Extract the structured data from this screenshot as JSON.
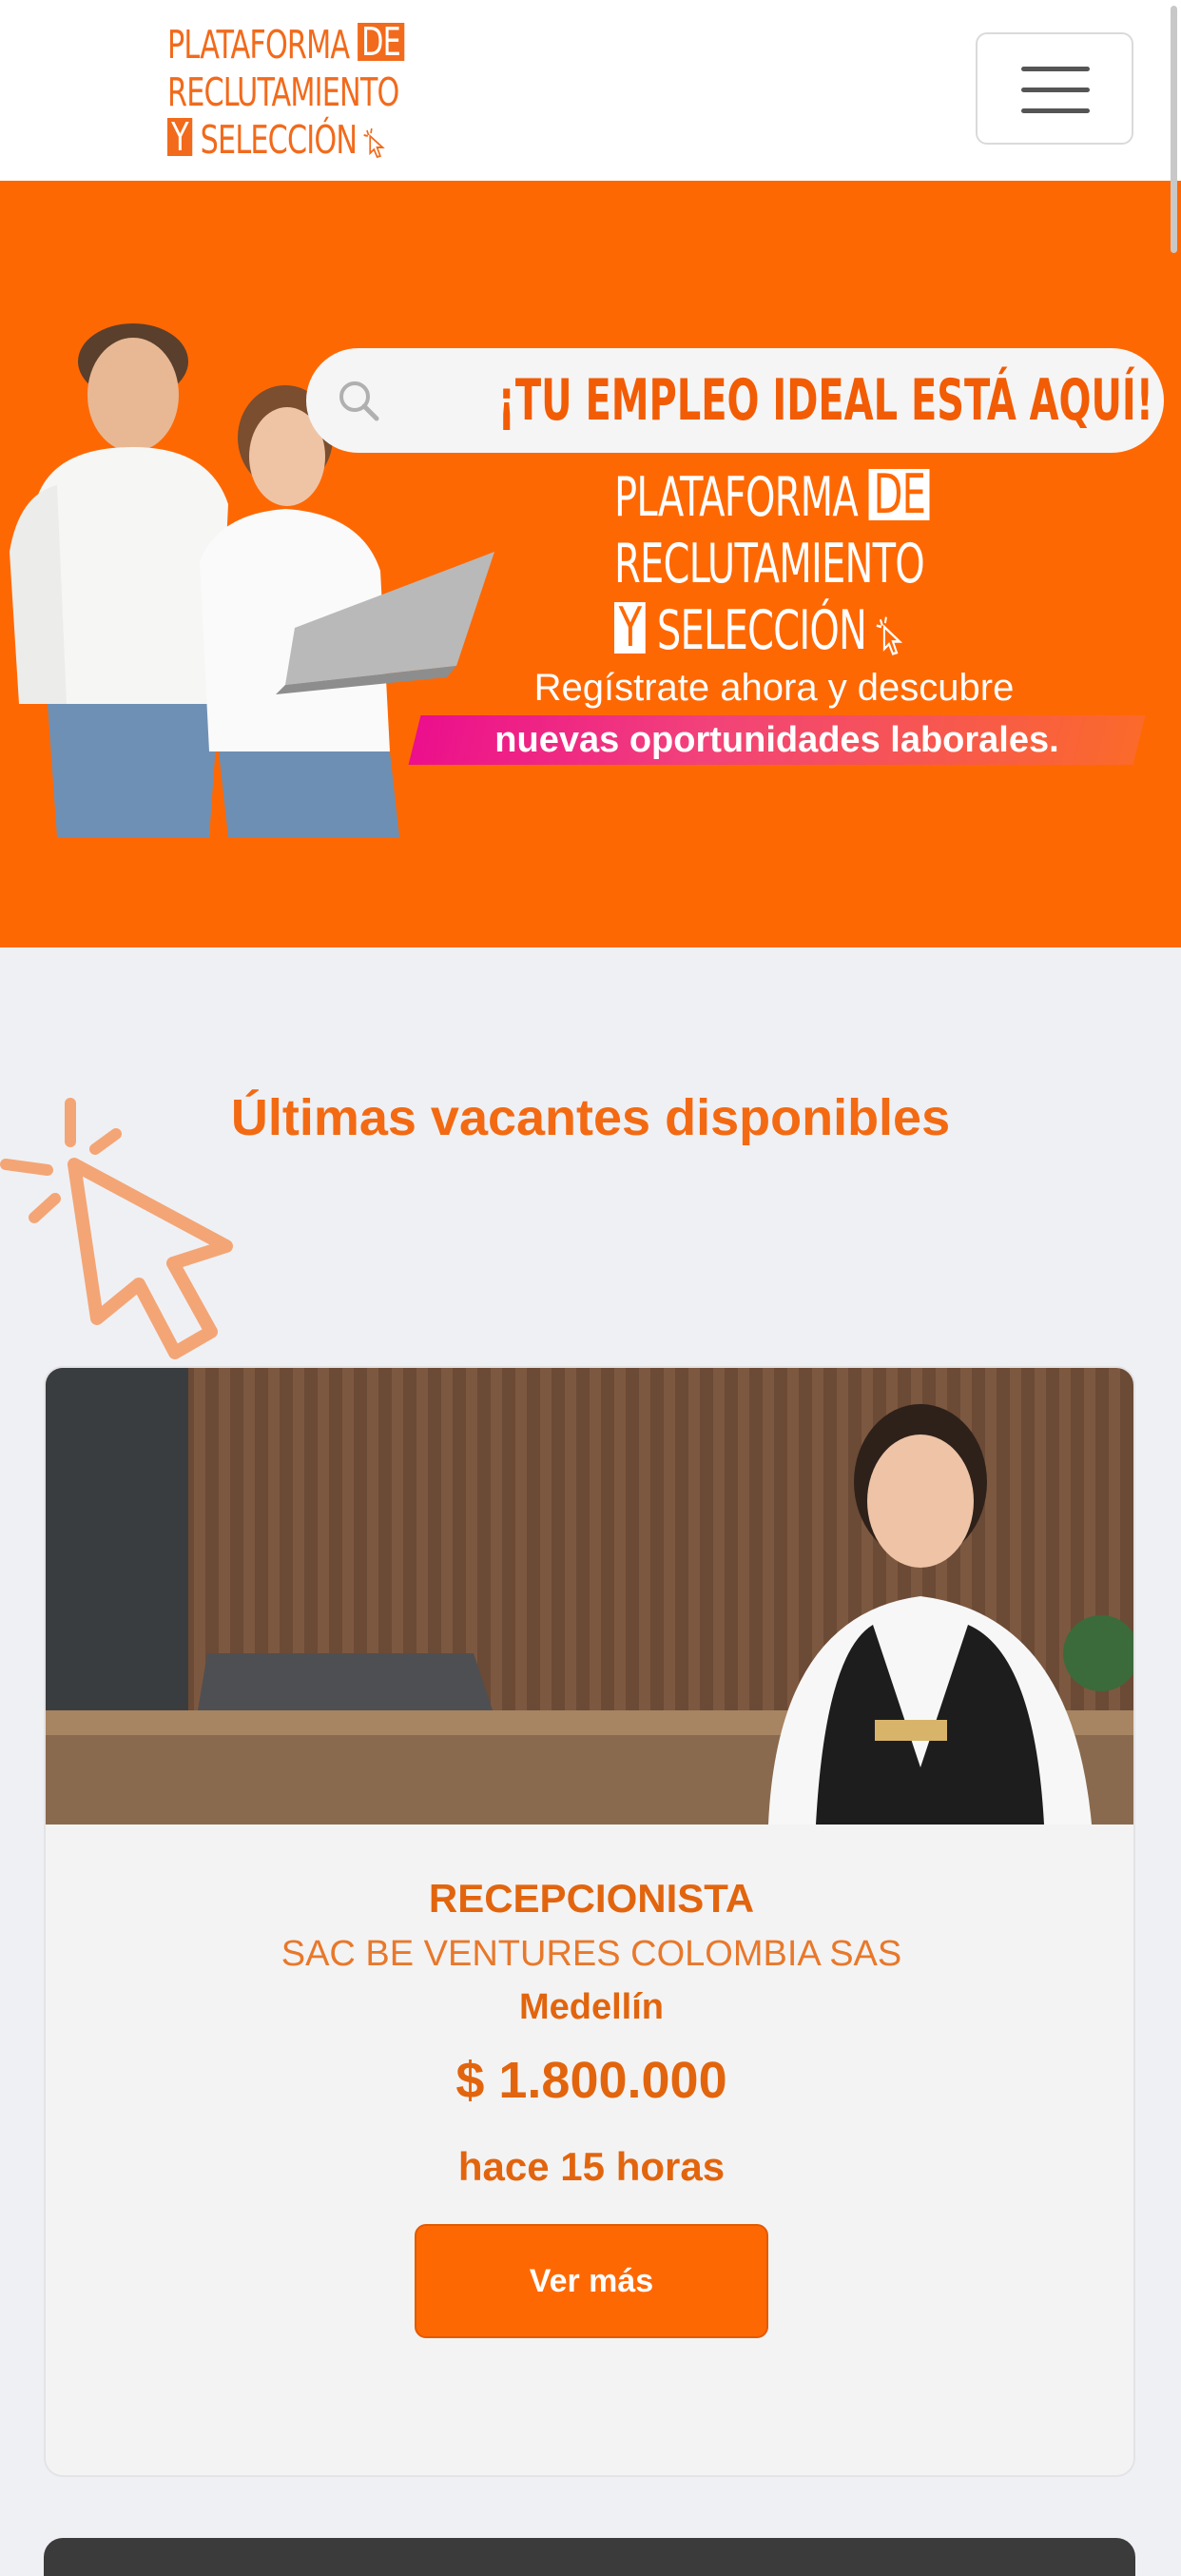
{
  "header": {
    "logo_line1": "PLATAFORMA",
    "logo_box1": "DE",
    "logo_line2": "RECLUTAMIENTO",
    "logo_box3": "Y",
    "logo_line3": "SELECCIÓN",
    "menu_icon": "hamburger-icon"
  },
  "hero": {
    "search_text": "¡TU EMPLEO IDEAL ESTÁ AQUÍ!",
    "search_icon": "search-icon",
    "logo_line1": "PLATAFORMA",
    "logo_box1": "DE",
    "logo_line2": "RECLUTAMIENTO",
    "logo_box3": "Y",
    "logo_line3": "SELECCIÓN",
    "tagline": "Regístrate ahora y descubre",
    "highlight": "nuevas oportunidades laborales.",
    "background_color": "#fe6803"
  },
  "vacancies": {
    "title": "Últimas vacantes disponibles",
    "cursor_icon": "cursor-click-icon",
    "jobs": [
      {
        "title": "RECEPCIONISTA",
        "company": "SAC BE VENTURES COLOMBIA SAS",
        "city": "Medellín",
        "salary": "$ 1.800.000",
        "posted": "hace 15 horas",
        "button": "Ver más"
      }
    ]
  },
  "colors": {
    "accent": "#fe6803",
    "text_accent": "#e2650e",
    "page_background": "#eff0f4"
  }
}
